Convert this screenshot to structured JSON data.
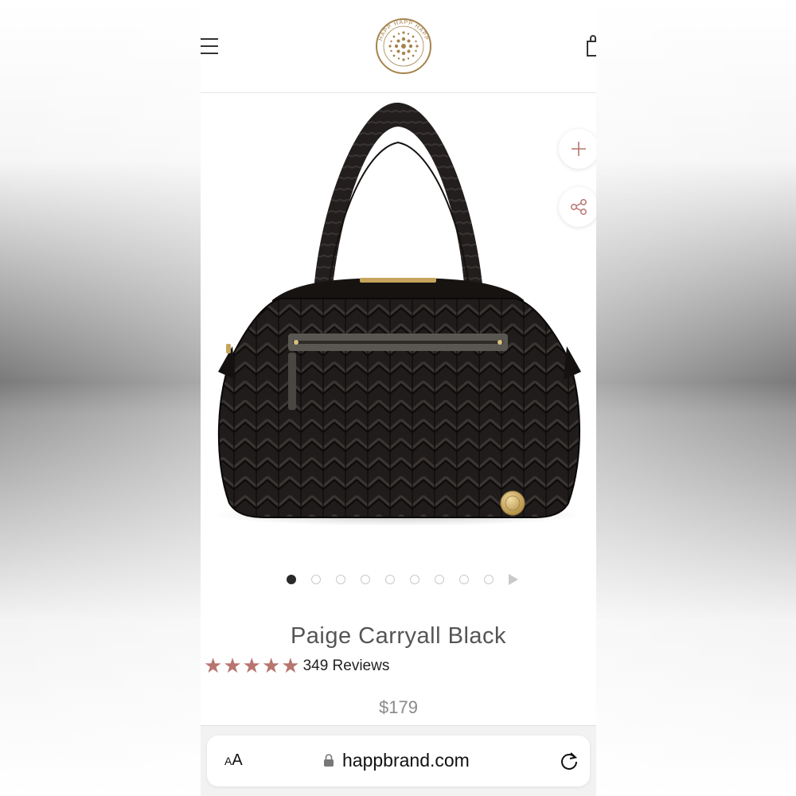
{
  "header": {
    "logo_text": "HAPP HAPP HAPP"
  },
  "product": {
    "title": "Paige Carryall Black",
    "rating_stars": 5,
    "reviews": "349 Reviews",
    "price": "$179",
    "gallery_total": 9,
    "gallery_active_index": 0
  },
  "browser": {
    "text_size_label": "AA",
    "url": "happbrand.com"
  },
  "colors": {
    "star": "#b8746f",
    "logo_gold": "#a6844e",
    "bag": "#1f1c1b"
  },
  "icons": [
    "menu-icon",
    "shopping-bag-icon",
    "plus-icon",
    "share-icon",
    "lock-icon",
    "reload-icon",
    "chevron-right-icon"
  ]
}
